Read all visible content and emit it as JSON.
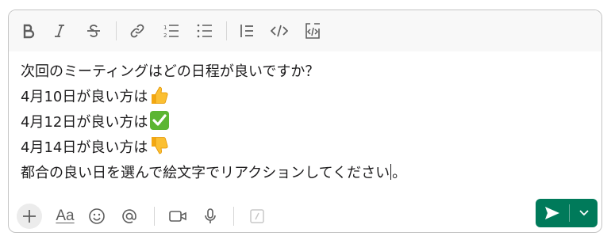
{
  "toolbar": {
    "items": [
      "bold-icon",
      "italic-icon",
      "strikethrough-icon",
      "link-icon",
      "ordered-list-icon",
      "bulleted-list-icon",
      "blockquote-icon",
      "code-icon",
      "code-block-icon"
    ]
  },
  "message": {
    "lines": [
      {
        "text": "次回のミーティングはどの日程が良いですか？"
      },
      {
        "text": "4月10日が良い方は",
        "emoji": "thumbs-up-emoji"
      },
      {
        "text": "4月12日が良い方は",
        "emoji": "check-mark-emoji"
      },
      {
        "text": "4月14日が良い方は",
        "emoji": "thumbs-down-emoji"
      },
      {
        "text_before_caret": "都合の良い日を選んで絵文字でリアクションしてください",
        "text_after_caret": "。"
      }
    ]
  },
  "bottombar": {
    "items": [
      "plus-icon",
      "formatting-icon",
      "emoji-icon",
      "mention-icon",
      "video-icon",
      "microphone-icon",
      "shortcuts-icon"
    ],
    "formatting_label": "Aa"
  },
  "send": {
    "color": "#007a5a",
    "icons": [
      "send-icon",
      "chevron-down-icon"
    ]
  }
}
